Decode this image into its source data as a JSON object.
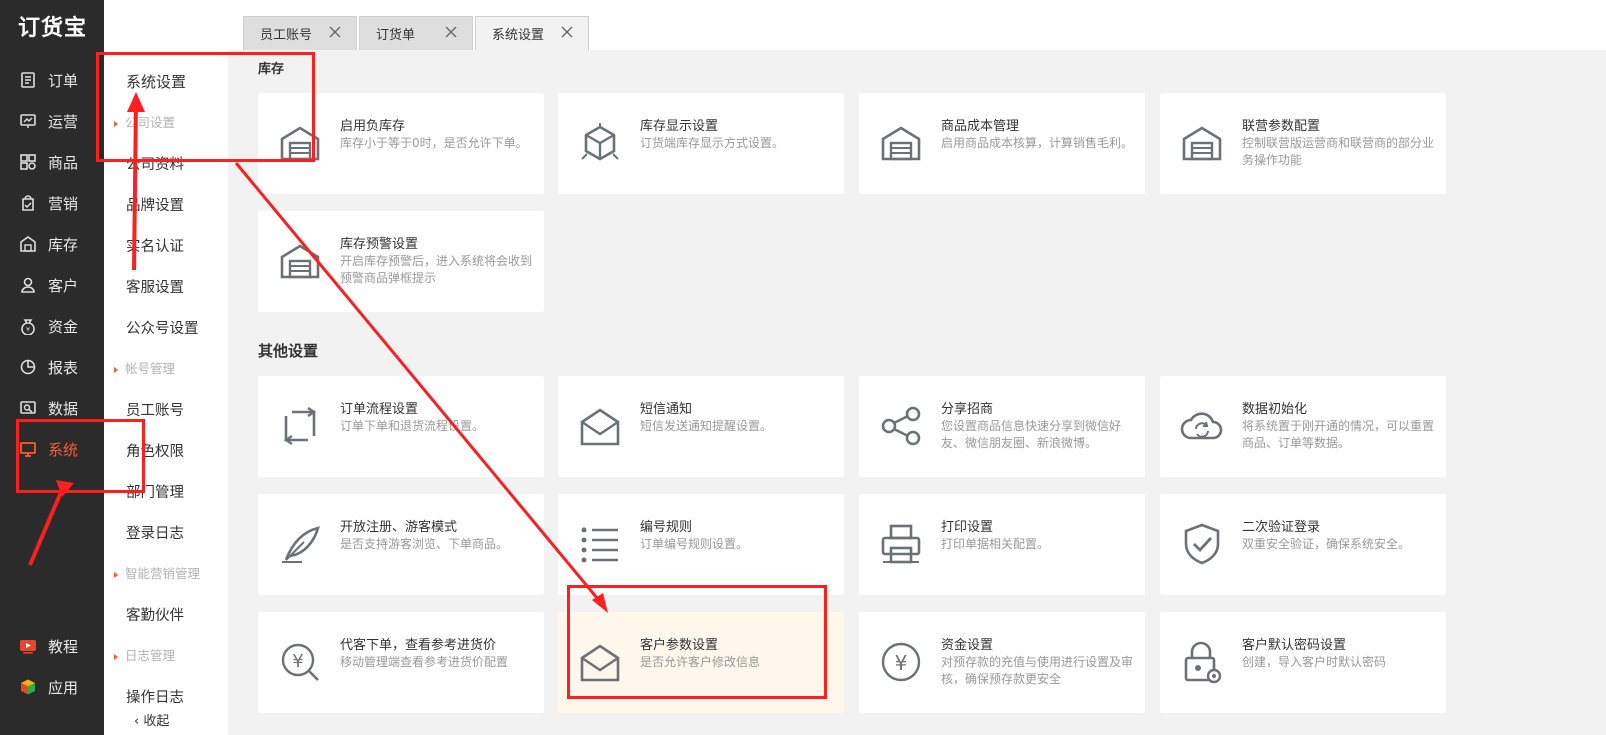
{
  "app": {
    "logo": "订货宝"
  },
  "nav": {
    "items": [
      {
        "label": "订单",
        "icon": "order-icon"
      },
      {
        "label": "运营",
        "icon": "operation-icon"
      },
      {
        "label": "商品",
        "icon": "product-icon"
      },
      {
        "label": "营销",
        "icon": "marketing-icon"
      },
      {
        "label": "库存",
        "icon": "warehouse-icon"
      },
      {
        "label": "客户",
        "icon": "customer-icon"
      },
      {
        "label": "资金",
        "icon": "money-bag-icon"
      },
      {
        "label": "报表",
        "icon": "pie-chart-icon"
      },
      {
        "label": "数据",
        "icon": "data-icon"
      },
      {
        "label": "系统",
        "icon": "monitor-icon"
      }
    ],
    "bottom": [
      {
        "label": "教程",
        "icon": "video-icon"
      },
      {
        "label": "应用",
        "icon": "cube-icon"
      }
    ],
    "active_color": "#ff5a35"
  },
  "submenu": {
    "title": "系统设置",
    "groups": {
      "company": "公司设置",
      "account": "帐号管理",
      "smart": "智能营销管理",
      "log": "日志管理"
    },
    "items": {
      "company_info": "公司资料",
      "brand": "品牌设置",
      "realname": "实名认证",
      "service": "客服设置",
      "official": "公众号设置",
      "staff": "员工账号",
      "role": "角色权限",
      "dept": "部门管理",
      "login_log": "登录日志",
      "partner": "客勤伙伴",
      "op_log": "操作日志",
      "collapse": "收起"
    }
  },
  "tabs": [
    {
      "label": "员工账号"
    },
    {
      "label": "订货单"
    },
    {
      "label": "系统设置"
    }
  ],
  "sections": {
    "inventory": "库存",
    "other": "其他设置"
  },
  "cards": {
    "inventory": [
      {
        "title": "启用负库存",
        "desc": "库存小于等于0时，是否允许下单。",
        "icon": "warehouse-icon"
      },
      {
        "title": "库存显示设置",
        "desc": "订货端库存显示方式设置。",
        "icon": "box-icon"
      },
      {
        "title": "商品成本管理",
        "desc": "启用商品成本核算，计算销售毛利。",
        "icon": "warehouse-icon"
      },
      {
        "title": "联营参数配置",
        "desc": "控制联营版运营商和联营商的部分业务操作功能",
        "icon": "warehouse-icon"
      },
      {
        "title": "库存预警设置",
        "desc": "开启库存预警后，进入系统将会收到预警商品弹框提示",
        "icon": "warehouse-icon"
      }
    ],
    "other": [
      {
        "title": "订单流程设置",
        "desc": "订单下单和退货流程设置。",
        "icon": "flow-icon"
      },
      {
        "title": "短信通知",
        "desc": "短信发送通知提醒设置。",
        "icon": "envelope-icon"
      },
      {
        "title": "分享招商",
        "desc": "您设置商品信息快速分享到微信好友、微信朋友圈、新浪微博。",
        "icon": "share-icon"
      },
      {
        "title": "数据初始化",
        "desc": "将系统置于刚开通的情况，可以重置商品、订单等数据。",
        "icon": "cloud-sync-icon"
      },
      {
        "title": "开放注册、游客模式",
        "desc": "是否支持游客浏览、下单商品。",
        "icon": "feather-icon"
      },
      {
        "title": "编号规则",
        "desc": "订单编号规则设置。",
        "icon": "list-icon"
      },
      {
        "title": "打印设置",
        "desc": "打印单据相关配置。",
        "icon": "printer-icon"
      },
      {
        "title": "二次验证登录",
        "desc": "双重安全验证，确保系统安全。",
        "icon": "shield-check-icon"
      },
      {
        "title": "代客下单，查看参考进货价",
        "desc": "移动管理端查看参考进货价配置",
        "icon": "yen-search-icon"
      },
      {
        "title": "客户参数设置",
        "desc": "是否允许客户修改信息",
        "icon": "envelope-icon"
      },
      {
        "title": "资金设置",
        "desc": "对预存款的充值与使用进行设置及审核，确保预存款更安全",
        "icon": "yen-circle-icon"
      },
      {
        "title": "客户默认密码设置",
        "desc": "创建，导入客户时默认密码",
        "icon": "lock-gear-icon"
      }
    ]
  },
  "colors": {
    "annotation": "#ff1f1f",
    "highlight_card": "#fff6ec",
    "icon": "#6b7177"
  }
}
